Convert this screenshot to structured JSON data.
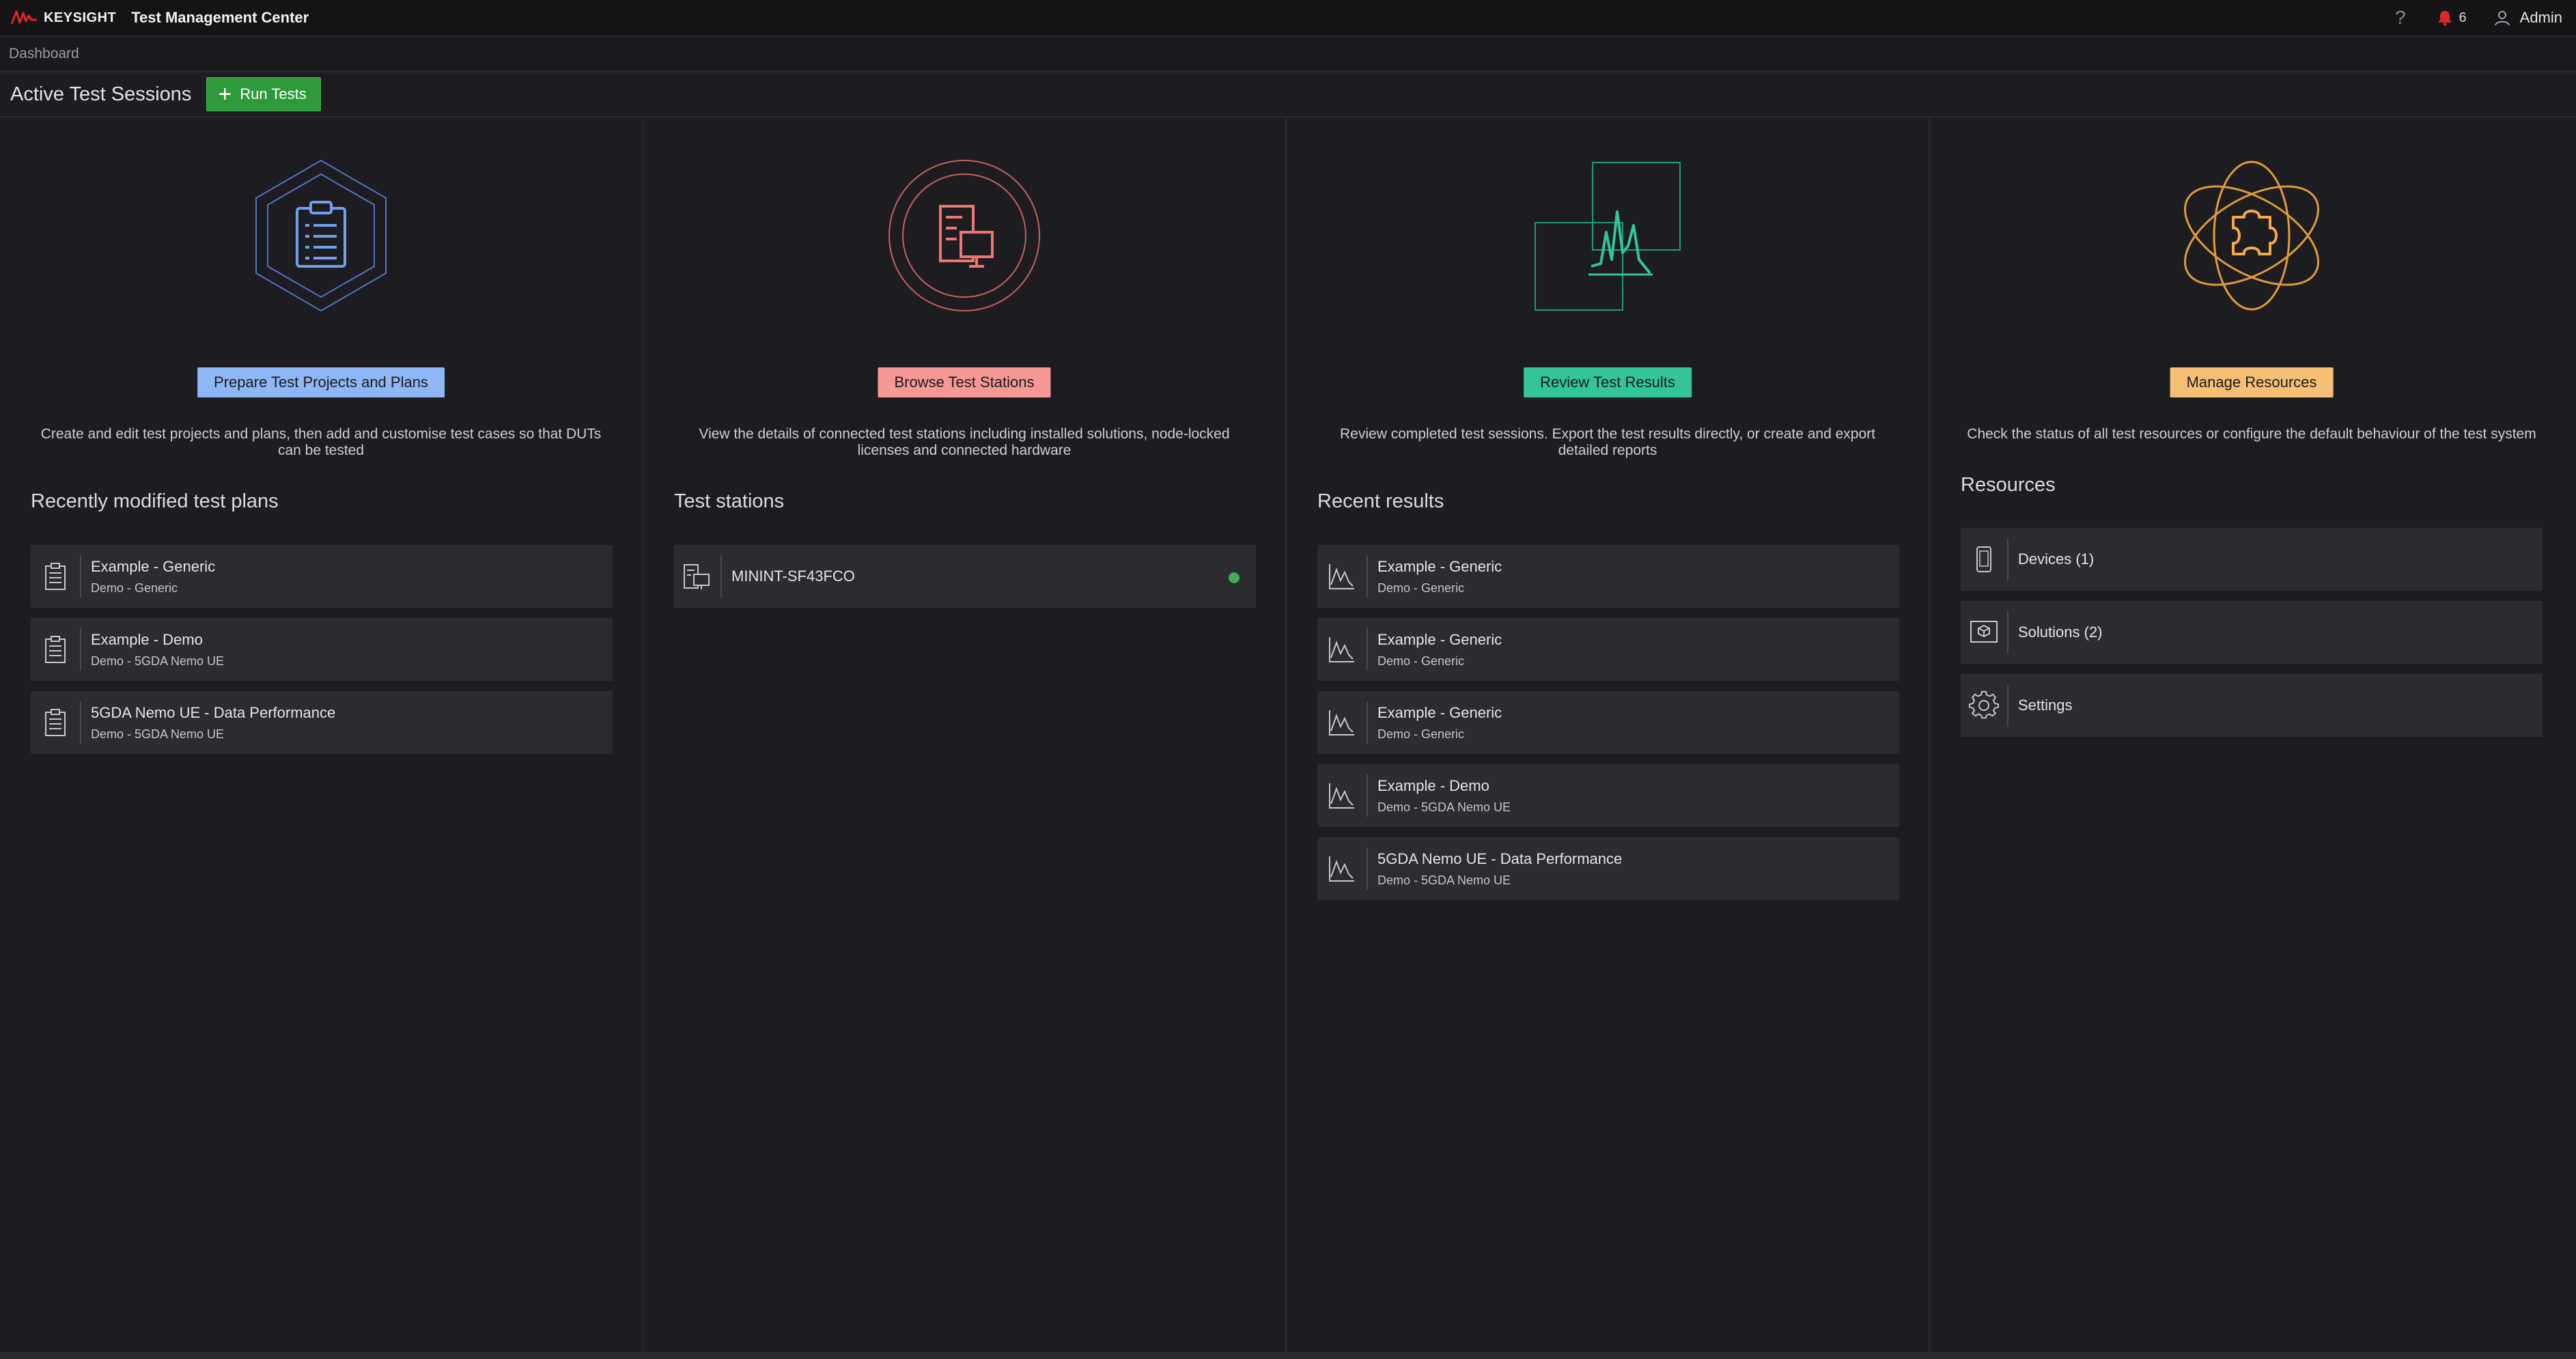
{
  "header": {
    "brand": "KEYSIGHT",
    "app_title": "Test Management Center",
    "help_label": "?",
    "notification_count": "6",
    "user_name": "Admin"
  },
  "breadcrumb": "Dashboard",
  "sessions": {
    "title": "Active Test Sessions",
    "run_label": "Run Tests"
  },
  "columns": [
    {
      "button_label": "Prepare Test Projects and Plans",
      "button_color": "#8fb6f5",
      "description": "Create and edit test projects and plans, then add and customise test cases so that DUTs can be tested",
      "section_title": "Recently modified test plans",
      "items": [
        {
          "title": "Example - Generic",
          "subtitle": "Demo - Generic"
        },
        {
          "title": "Example - Demo",
          "subtitle": "Demo - 5GDA Nemo UE"
        },
        {
          "title": "5GDA Nemo UE - Data Performance",
          "subtitle": "Demo - 5GDA Nemo UE"
        }
      ]
    },
    {
      "button_label": "Browse Test Stations",
      "button_color": "#f59896",
      "description": "View the details of connected test stations including installed solutions, node-locked licenses and connected hardware",
      "section_title": "Test stations",
      "items": [
        {
          "title": "MININT-SF43FCO",
          "status": "online"
        }
      ]
    },
    {
      "button_label": "Review Test Results",
      "button_color": "#34c49a",
      "description": "Review completed test sessions. Export the test results directly, or create and export detailed reports",
      "section_title": "Recent results",
      "items": [
        {
          "title": "Example - Generic",
          "subtitle": "Demo - Generic"
        },
        {
          "title": "Example - Generic",
          "subtitle": "Demo - Generic"
        },
        {
          "title": "Example - Generic",
          "subtitle": "Demo - Generic"
        },
        {
          "title": "Example - Demo",
          "subtitle": "Demo - 5GDA Nemo UE"
        },
        {
          "title": "5GDA Nemo UE - Data Performance",
          "subtitle": "Demo - 5GDA Nemo UE"
        }
      ]
    },
    {
      "button_label": "Manage Resources",
      "button_color": "#f5bf75",
      "description": "Check the status of all test resources or configure the default behaviour of the test system",
      "section_title": "Resources",
      "items": [
        {
          "title": "Devices (1)",
          "icon": "device-icon"
        },
        {
          "title": "Solutions (2)",
          "icon": "solution-icon"
        },
        {
          "title": "Settings",
          "icon": "gear-icon"
        }
      ]
    }
  ],
  "colors": {
    "background": "#1d1d21",
    "row": "#2b2b30",
    "run_button": "#2e9a3c",
    "brand_red": "#e2252b",
    "status_online": "#3fae56"
  }
}
